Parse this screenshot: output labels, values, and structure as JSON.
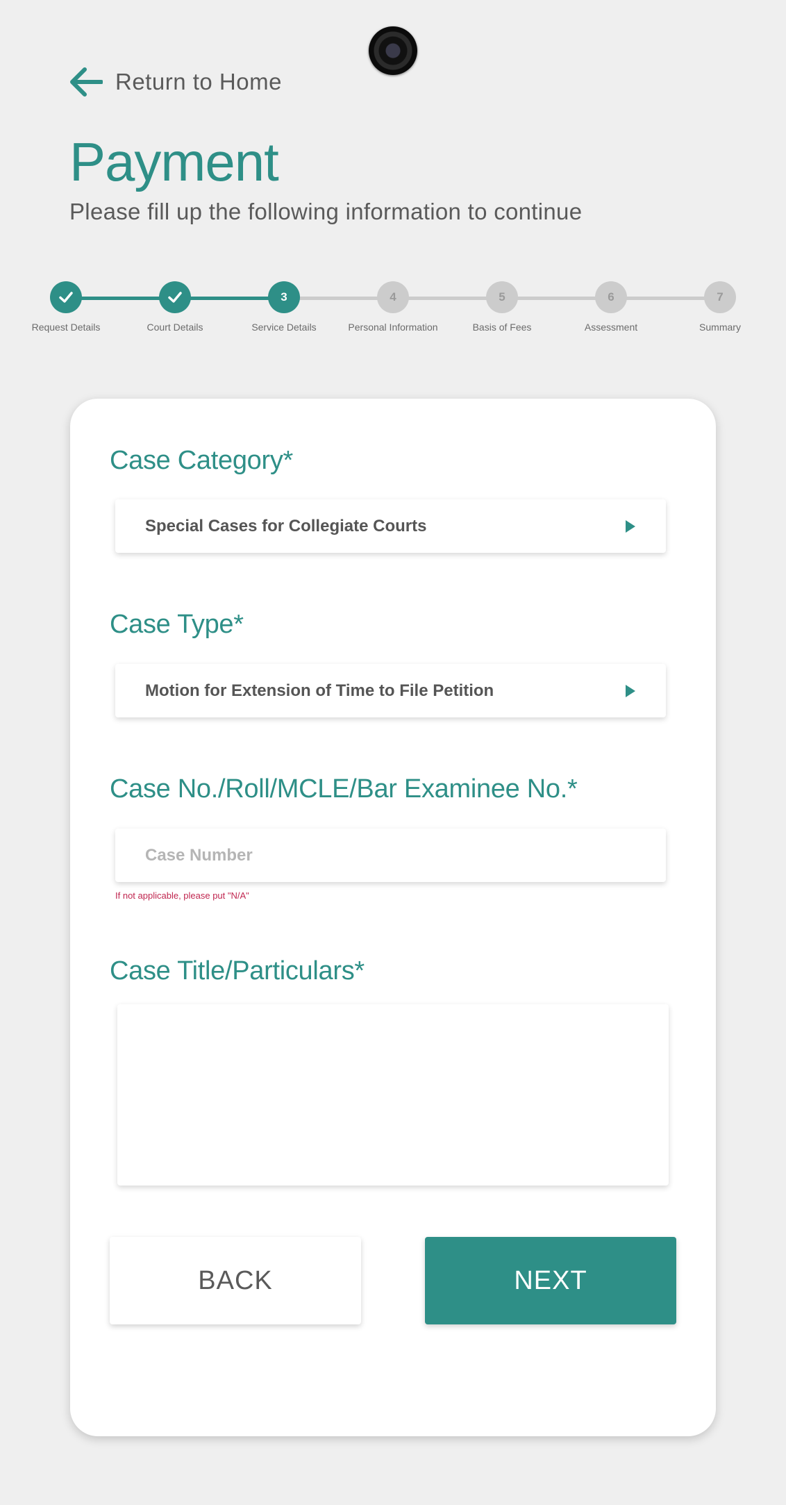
{
  "header": {
    "back_link": "Return to Home",
    "title": "Payment",
    "subtitle": "Please fill up the following information to continue"
  },
  "colors": {
    "accent": "#2e8f87",
    "inactive": "#cccccc",
    "error": "#c0264f"
  },
  "stepper": {
    "current_step": 3,
    "steps": [
      {
        "number": "1",
        "label": "Request Details",
        "status": "done"
      },
      {
        "number": "2",
        "label": "Court Details",
        "status": "done"
      },
      {
        "number": "3",
        "label": "Service Details",
        "status": "current"
      },
      {
        "number": "4",
        "label": "Personal Information",
        "status": "todo"
      },
      {
        "number": "5",
        "label": "Basis of Fees",
        "status": "todo"
      },
      {
        "number": "6",
        "label": "Assessment",
        "status": "todo"
      },
      {
        "number": "7",
        "label": "Summary",
        "status": "todo"
      }
    ]
  },
  "form": {
    "case_category": {
      "label": "Case Category*",
      "value": "Special Cases for Collegiate Courts"
    },
    "case_type": {
      "label": "Case Type*",
      "value": "Motion for Extension of Time to File Petition"
    },
    "case_number": {
      "label": "Case No./Roll/MCLE/Bar Examinee No.*",
      "placeholder": "Case Number",
      "value": "",
      "hint": "If not applicable, please put \"N/A\""
    },
    "case_title": {
      "label": "Case Title/Particulars*",
      "value": ""
    }
  },
  "buttons": {
    "back": "BACK",
    "next": "NEXT"
  }
}
